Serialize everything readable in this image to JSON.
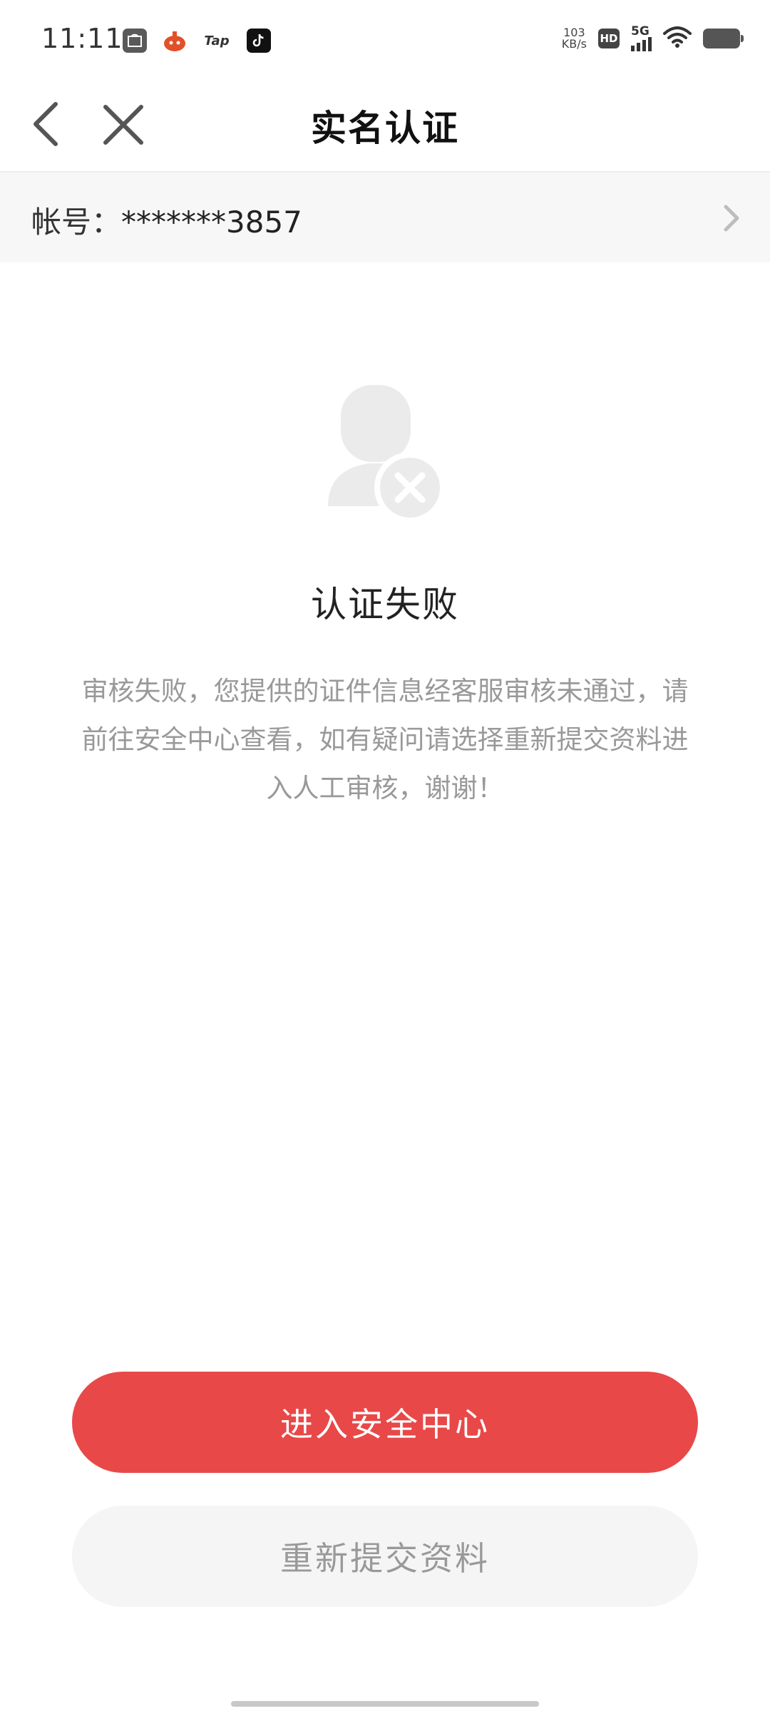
{
  "status_bar": {
    "time": "11:11",
    "apps": [
      {
        "icon": "huawei-appgallery-icon",
        "color": "#5a5a5a"
      },
      {
        "icon": "game-app-icon",
        "color": "#e2502a"
      },
      {
        "icon": "taptap-icon",
        "color": "#ffffff",
        "text": "Tap"
      },
      {
        "icon": "tiktok-icon",
        "color": "#111111"
      }
    ],
    "net_speed_value": "103",
    "net_speed_unit": "KB/s",
    "hd_label": "HD",
    "network": "5G",
    "icons": [
      "wifi-icon",
      "battery-icon"
    ]
  },
  "header": {
    "title": "实名认证",
    "back_icon": "chevron-left-icon",
    "close_icon": "close-icon"
  },
  "account": {
    "label": "帐号：",
    "value": "*******3857",
    "chevron_icon": "chevron-right-icon"
  },
  "result": {
    "icon": "user-failed-icon",
    "title": "认证失败",
    "description": "审核失败，您提供的证件信息经客服审核未通过，请前往安全中心查看，如有疑问请选择重新提交资料进入人工审核，谢谢！"
  },
  "actions": {
    "primary_label": "进入安全中心",
    "secondary_label": "重新提交资料"
  },
  "colors": {
    "accent": "#e94848",
    "secondary_bg": "#f5f5f5",
    "muted_text": "#999999",
    "icon_gray": "#ebebeb"
  }
}
